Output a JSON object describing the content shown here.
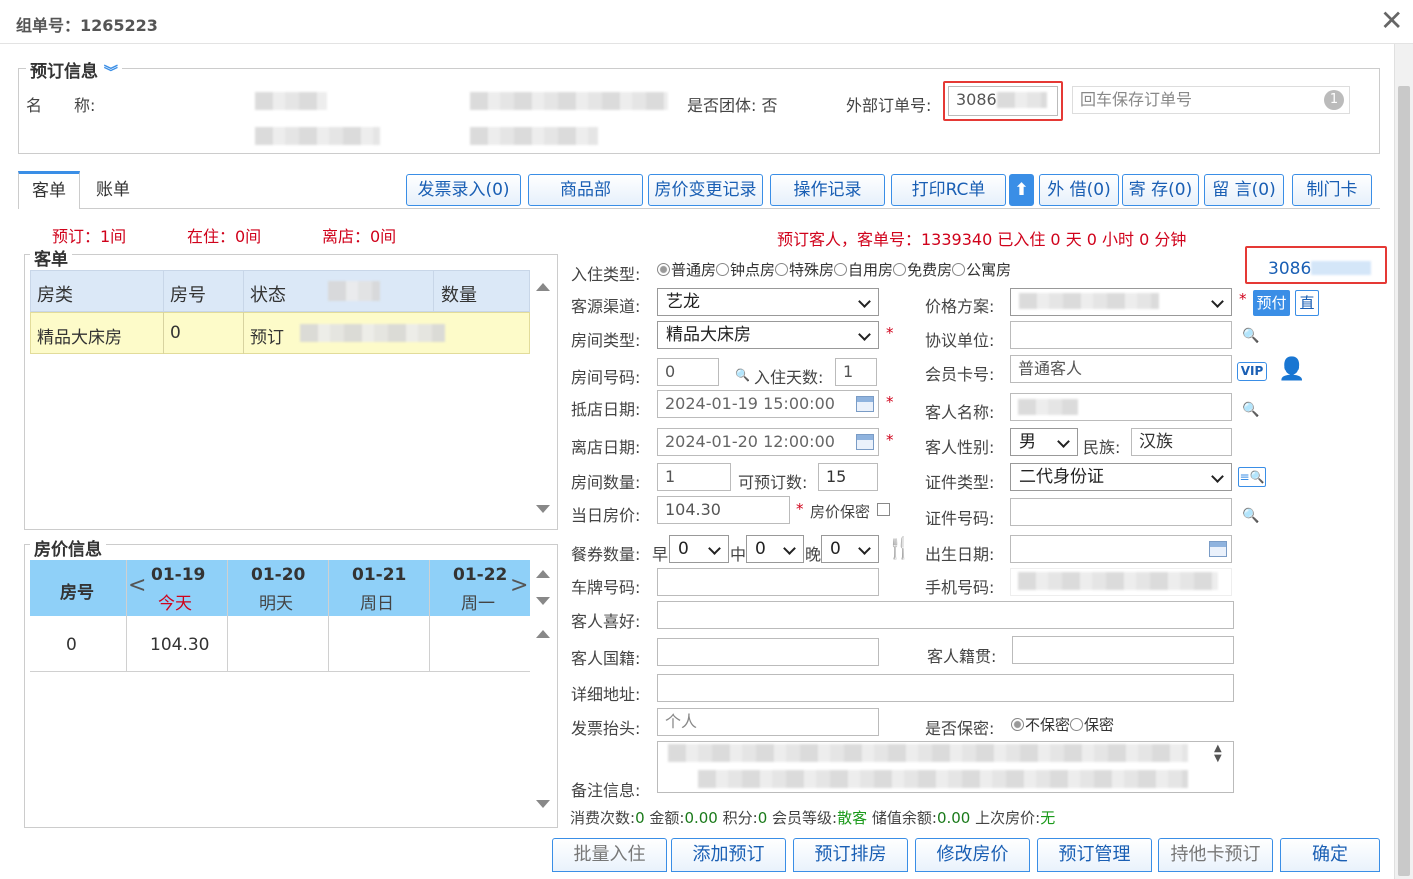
{
  "window": {
    "title": "组单号：1265223"
  },
  "booking": {
    "legend": "预订信息",
    "name_label": "名　　称:",
    "group_label": "是否团体:",
    "group_value": "否",
    "ext_order_label": "外部订单号:",
    "ext_order_value": "3086",
    "ext_order_placeholder": "回车保存订单号",
    "ext_order_badge": "1"
  },
  "tabs": [
    {
      "label": "客单"
    },
    {
      "label": "账单"
    }
  ],
  "toolbar": [
    "发票录入(0)",
    "商品部",
    "房价变更记录",
    "操作记录",
    "打印RC单",
    "外 借(0)",
    "寄 存(0)",
    "留 言(0)",
    "制门卡"
  ],
  "status": {
    "reserve": "预订：1间",
    "inhouse": "在住：0间",
    "checkout": "离店：0间",
    "message": "预订客人，客单号：1339340 已入住 0 天 0 小时 0 分钟"
  },
  "guest_list": {
    "legend": "客单",
    "columns": [
      "房类",
      "房号",
      "状态",
      "数量"
    ],
    "rows": [
      {
        "type": "精品大床房",
        "room": "0",
        "status": "预订"
      }
    ]
  },
  "rate_info": {
    "legend": "房价信息",
    "room_header": "房号",
    "days": [
      {
        "date": "01-19",
        "day": "今天"
      },
      {
        "date": "01-20",
        "day": "明天"
      },
      {
        "date": "01-21",
        "day": "周日"
      },
      {
        "date": "01-22",
        "day": "周一"
      }
    ],
    "row": {
      "room": "0",
      "price": "104.30"
    }
  },
  "form": {
    "checkin_type_label": "入住类型:",
    "checkin_types": [
      "普通房",
      "钟点房",
      "特殊房",
      "自用房",
      "免费房",
      "公寓房"
    ],
    "ext_no": "3086",
    "source_label": "客源渠道:",
    "source_value": "艺龙",
    "plan_label": "价格方案:",
    "prepay": "预付",
    "direct": "直",
    "roomtype_label": "房间类型:",
    "roomtype_value": "精品大床房",
    "agreement_label": "协议单位:",
    "roomno_label": "房间号码:",
    "roomno_value": "0",
    "days_label": "入住天数:",
    "days_value": "1",
    "member_label": "会员卡号:",
    "member_value": "普通客人",
    "vip": "VIP",
    "arrive_label": "抵店日期:",
    "arrive_value": "2024-01-19 15:00:00",
    "guestname_label": "客人名称:",
    "depart_label": "离店日期:",
    "depart_value": "2024-01-20 12:00:00",
    "gender_label": "客人性别:",
    "gender_value": "男",
    "ethnic_label": "民族:",
    "ethnic_value": "汉族",
    "roomcount_label": "房间数量:",
    "roomcount_value": "1",
    "available_label": "可预订数:",
    "available_value": "15",
    "idtype_label": "证件类型:",
    "idtype_value": "二代身份证",
    "dayrate_label": "当日房价:",
    "dayrate_value": "104.30",
    "secret_rate_label": "房价保密",
    "idno_label": "证件号码:",
    "meal_label": "餐券数量:",
    "breakfast": "早",
    "lunch": "中",
    "dinner": "晚",
    "meal_values": [
      "0",
      "0",
      "0"
    ],
    "birth_label": "出生日期:",
    "plate_label": "车牌号码:",
    "phone_label": "手机号码:",
    "hobby_label": "客人喜好:",
    "nation_label": "客人国籍:",
    "native_label": "客人籍贯:",
    "address_label": "详细地址:",
    "invoice_label": "发票抬头:",
    "invoice_value": "个人",
    "secret_label": "是否保密:",
    "secret_options": [
      "不保密",
      "保密"
    ],
    "remark_label": "备注信息:"
  },
  "summary": {
    "count_label": "消费次数:",
    "count": "0",
    "amount_label": "金额:",
    "amount": "0.00",
    "points_label": "积分:",
    "points": "0",
    "level_label": "会员等级:",
    "level": "散客",
    "balance_label": "储值余额:",
    "balance": "0.00",
    "lastrate_label": "上次房价:",
    "lastrate": "无"
  },
  "bottom_buttons": [
    "批量入住",
    "添加预订",
    "预订排房",
    "修改房价",
    "预订管理",
    "持他卡预订",
    "确定"
  ]
}
